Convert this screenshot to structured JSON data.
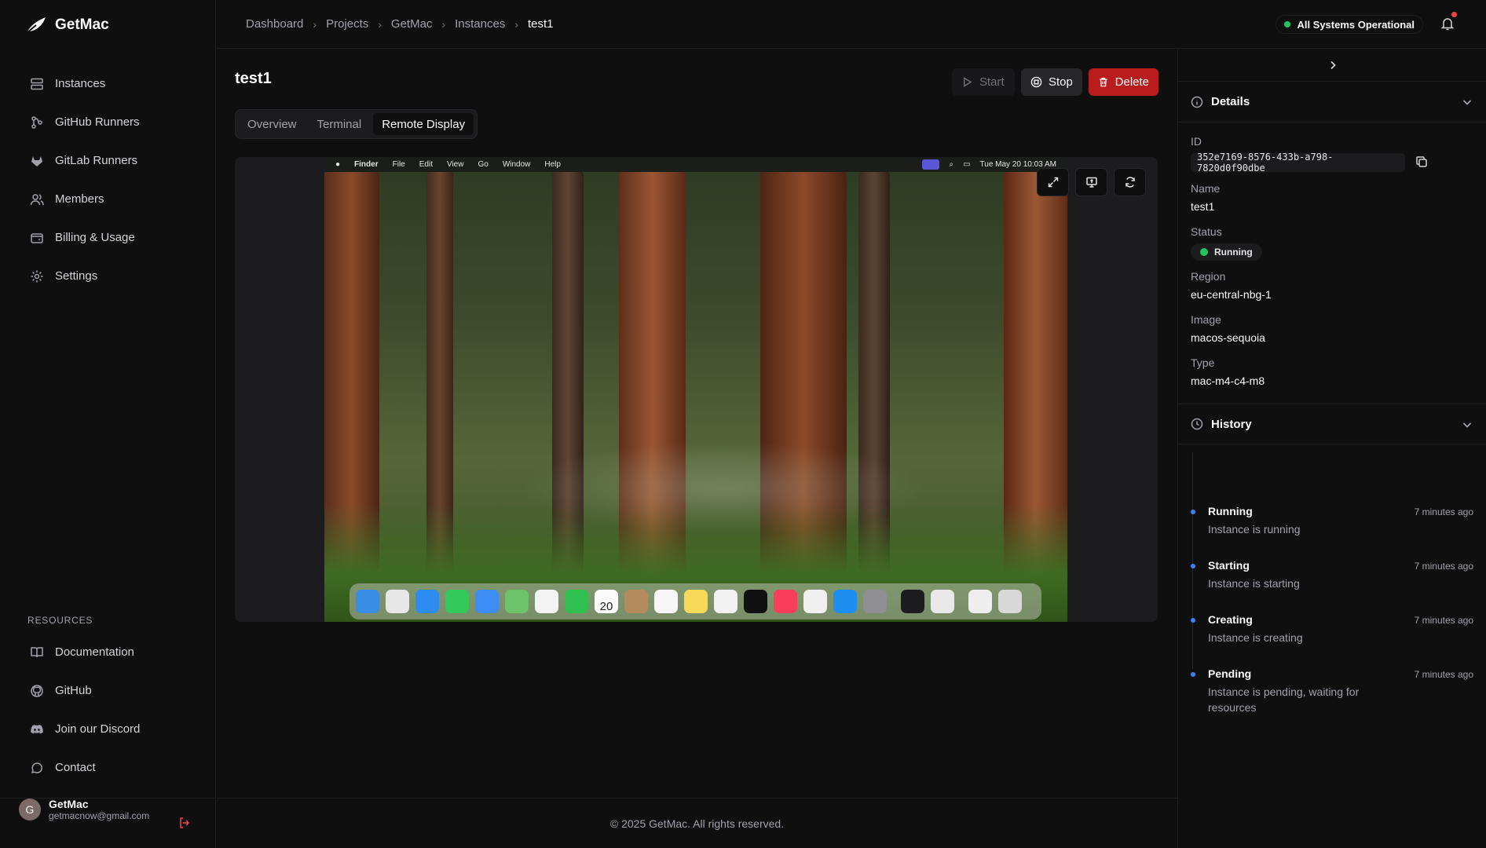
{
  "app": {
    "name": "GetMac"
  },
  "sidebar": {
    "nav": [
      {
        "label": "Instances",
        "icon": "server-icon"
      },
      {
        "label": "GitHub Runners",
        "icon": "github-runners-icon"
      },
      {
        "label": "GitLab Runners",
        "icon": "gitlab-icon"
      },
      {
        "label": "Members",
        "icon": "users-icon"
      },
      {
        "label": "Billing & Usage",
        "icon": "wallet-icon"
      },
      {
        "label": "Settings",
        "icon": "gear-icon"
      }
    ],
    "resources_label": "RESOURCES",
    "resources": [
      {
        "label": "Documentation",
        "icon": "book-icon"
      },
      {
        "label": "GitHub",
        "icon": "github-icon"
      },
      {
        "label": "Join our Discord",
        "icon": "discord-icon"
      },
      {
        "label": "Contact",
        "icon": "chat-icon"
      }
    ],
    "user": {
      "initial": "G",
      "name": "GetMac",
      "email": "getmacnow@gmail.com"
    }
  },
  "topbar": {
    "breadcrumbs": [
      "Dashboard",
      "Projects",
      "GetMac",
      "Instances",
      "test1"
    ],
    "system_status": "All Systems Operational"
  },
  "main": {
    "title": "test1",
    "actions": {
      "start": "Start",
      "stop": "Stop",
      "delete": "Delete"
    },
    "tabs": [
      {
        "label": "Overview",
        "active": false
      },
      {
        "label": "Terminal",
        "active": false
      },
      {
        "label": "Remote Display",
        "active": true
      }
    ],
    "remote_display": {
      "menubar": [
        "Finder",
        "File",
        "Edit",
        "View",
        "Go",
        "Window",
        "Help"
      ],
      "clock": "Tue May 20  10:03 AM",
      "dock_calendar_day": "20"
    }
  },
  "footer": {
    "copyright": "© 2025 GetMac. All rights reserved."
  },
  "details": {
    "heading": "Details",
    "id_label": "ID",
    "id_value": "352e7169-8576-433b-a798-7820d0f90dbe",
    "name_label": "Name",
    "name_value": "test1",
    "status_label": "Status",
    "status_value": "Running",
    "region_label": "Region",
    "region_value": "eu-central-nbg-1",
    "image_label": "Image",
    "image_value": "macos-sequoia",
    "type_label": "Type",
    "type_value": "mac-m4-c4-m8"
  },
  "history": {
    "heading": "History",
    "events": [
      {
        "title": "Running",
        "description": "Instance is running",
        "time": "7 minutes ago"
      },
      {
        "title": "Starting",
        "description": "Instance is starting",
        "time": "7 minutes ago"
      },
      {
        "title": "Creating",
        "description": "Instance is creating",
        "time": "7 minutes ago"
      },
      {
        "title": "Pending",
        "description": "Instance is pending, waiting for resources",
        "time": "7 minutes ago"
      }
    ]
  },
  "colors": {
    "accent_red": "#b91c1c",
    "status_green": "#22c55e",
    "timeline_blue": "#3b82f6"
  }
}
